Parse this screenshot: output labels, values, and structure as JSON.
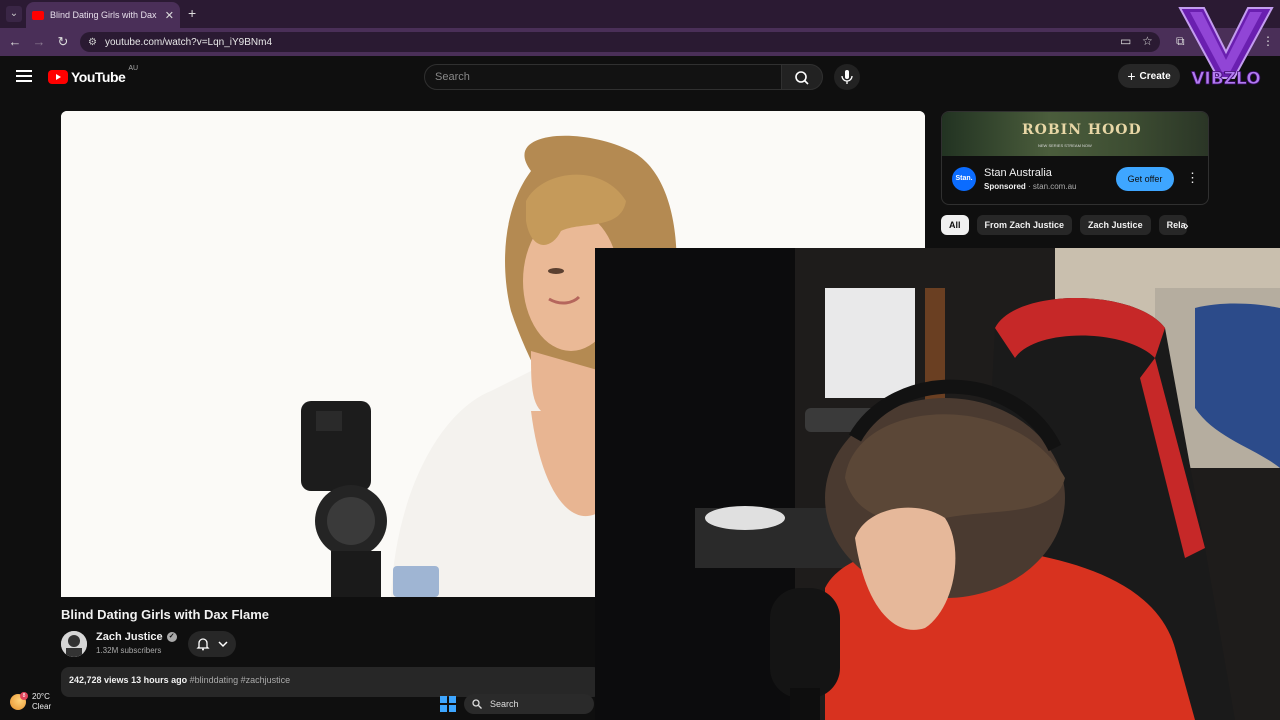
{
  "browser": {
    "tab_title": "Blind Dating Girls with Dax Flame",
    "url": "youtube.com/watch?v=Lqn_iY9BNm4"
  },
  "youtube": {
    "logo_text": "YouTube",
    "region": "AU",
    "search_placeholder": "Search",
    "create_label": "Create"
  },
  "overlay": {
    "watermark": "VIBZLO"
  },
  "video": {
    "title": "Blind Dating Girls with Dax Flame",
    "channel_name": "Zach Justice",
    "subscribers": "1.32M subscribers",
    "views": "242,728 views",
    "age": "13 hours ago",
    "hashtags": "#blinddating #zachjustice"
  },
  "ad": {
    "banner_title": "ROBIN HOOD",
    "banner_sub": "NEW SERIES STREAM NOW",
    "logo_text": "Stan.",
    "advertiser": "Stan Australia",
    "sponsored": "Sponsored",
    "domain": "stan.com.au",
    "cta": "Get offer"
  },
  "chips": [
    "All",
    "From Zach Justice",
    "Zach Justice",
    "Rela"
  ],
  "taskbar": {
    "temperature": "20°C",
    "condition": "Clear",
    "weather_badge": "8",
    "search_label": "Search"
  },
  "colors": {
    "youtube_red": "#ff0000",
    "accent_blue": "#3ea6ff",
    "chrome_purple": "#4a2f58",
    "watermark_purple": "#7b2cbf"
  }
}
